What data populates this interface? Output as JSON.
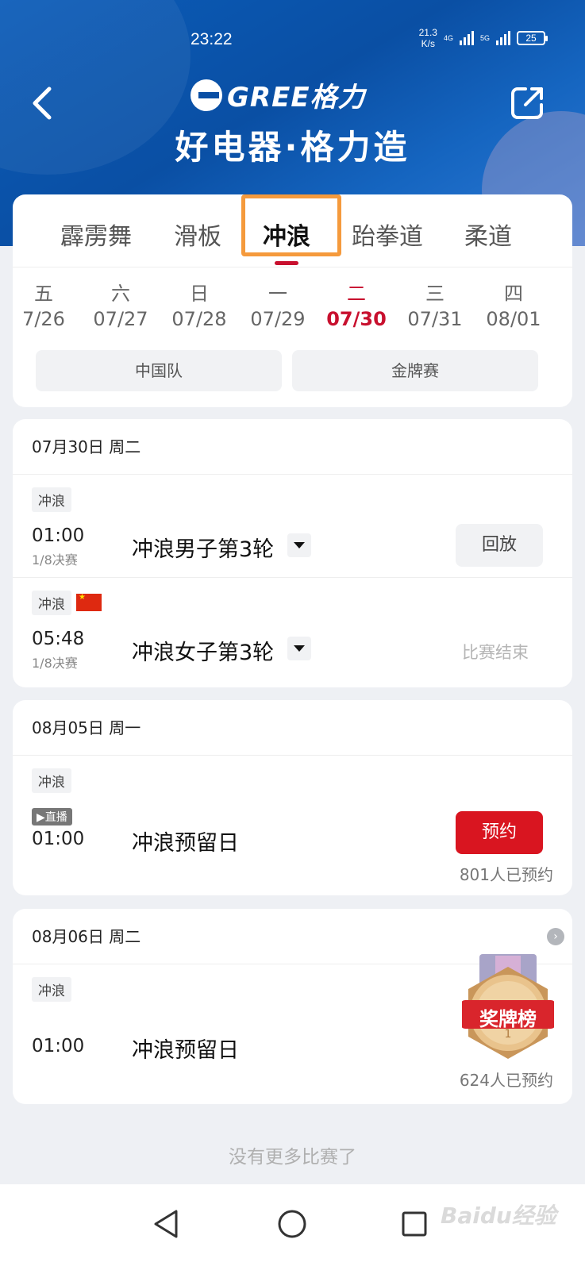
{
  "status_bar": {
    "time": "23:22",
    "net_speed_value": "21.3",
    "net_speed_unit": "K/s",
    "signal_1": "4G",
    "signal_2": "5G",
    "battery": "25"
  },
  "header": {
    "brand": "GREE格力",
    "slogan": "好电器·格力造"
  },
  "tabs": [
    {
      "label": "霹雳舞",
      "active": false
    },
    {
      "label": "滑板",
      "active": false
    },
    {
      "label": "冲浪",
      "active": true
    },
    {
      "label": "跆拳道",
      "active": false
    },
    {
      "label": "柔道",
      "active": false
    }
  ],
  "dates": [
    {
      "weekday": "五",
      "date": "7/26"
    },
    {
      "weekday": "六",
      "date": "07/27"
    },
    {
      "weekday": "日",
      "date": "07/28"
    },
    {
      "weekday": "一",
      "date": "07/29"
    },
    {
      "weekday": "二",
      "date": "07/30",
      "active": true
    },
    {
      "weekday": "三",
      "date": "07/31"
    },
    {
      "weekday": "四",
      "date": "08/01"
    }
  ],
  "filters": {
    "china_team": "中国队",
    "gold_medal": "金牌赛"
  },
  "sections": [
    {
      "heading": "07月30日 周二",
      "matches": [
        {
          "tag": "冲浪",
          "time": "01:00",
          "stage": "1/8决赛",
          "title": "冲浪男子第3轮",
          "action": "回放"
        },
        {
          "tag": "冲浪",
          "time": "05:48",
          "stage": "1/8决赛",
          "title": "冲浪女子第3轮",
          "status": "比赛结束"
        }
      ]
    },
    {
      "heading": "08月05日 周一",
      "matches": [
        {
          "tag": "冲浪",
          "live": "▶直播",
          "time": "01:00",
          "title": "冲浪预留日",
          "action": "预约",
          "count": "801人已预约"
        }
      ]
    },
    {
      "heading": "08月06日 周二",
      "matches": [
        {
          "tag": "冲浪",
          "time": "01:00",
          "title": "冲浪预留日",
          "count": "624人已预约"
        }
      ]
    }
  ],
  "medal_badge": "奖牌榜",
  "footer_text": "没有更多比赛了",
  "watermark": "Baidu经验",
  "colors": {
    "accent_red": "#c8102e",
    "header_blue": "#0a4fa4",
    "highlight_orange": "#f59a3c"
  }
}
